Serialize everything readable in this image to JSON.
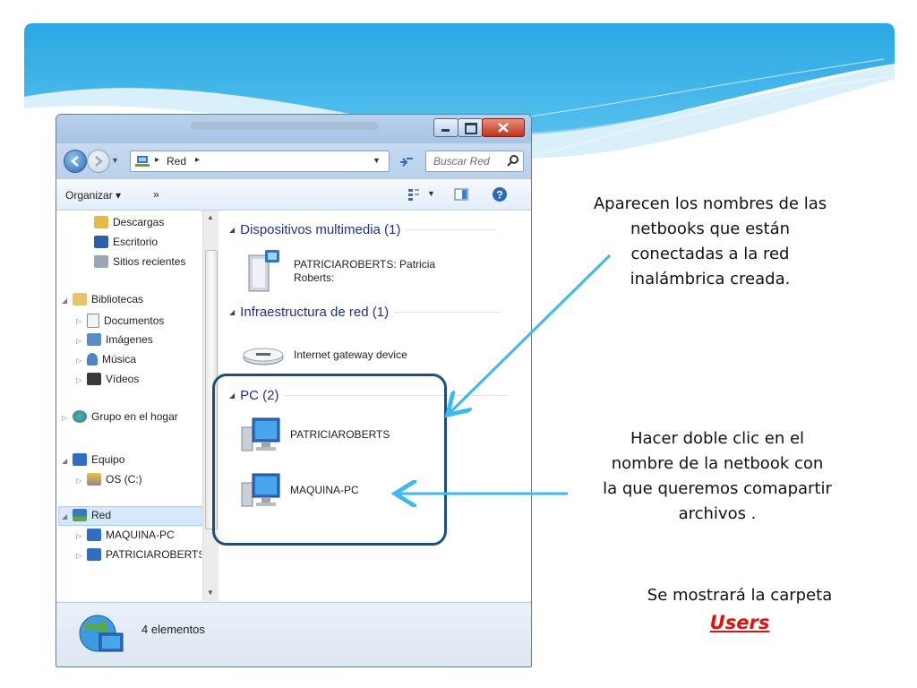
{
  "window": {
    "address_path": "Red",
    "search_placeholder": "Buscar Red",
    "toolbar": {
      "organize": "Organizar ▾",
      "more": "»"
    },
    "nav": {
      "downloads": "Descargas",
      "desktop": "Escritorio",
      "recent": "Sitios recientes",
      "libraries": "Bibliotecas",
      "documents": "Documentos",
      "pictures": "Imágenes",
      "music": "Música",
      "videos": "Vídeos",
      "homegroup": "Grupo en el hogar",
      "computer": "Equipo",
      "os_drive": "OS (C:)",
      "network": "Red",
      "net_item_1": "MAQUINA-PC",
      "net_item_2": "PATRICIAROBERTS"
    },
    "groups": {
      "multimedia": "Dispositivos multimedia (1)",
      "infra": "Infraestructura de red (1)",
      "pc": "PC (2)"
    },
    "items": {
      "media_device": "PATRICIAROBERTS: Patricia Roberts:",
      "gateway": "Internet gateway device",
      "pc1": "PATRICIAROBERTS",
      "pc2": "MAQUINA-PC"
    },
    "status_count": "4 elementos"
  },
  "callouts": {
    "top": [
      "Aparecen los nombres de las",
      "netbooks que están",
      "conectadas a la red",
      "inalámbrica creada."
    ],
    "middle": [
      "Hacer doble clic en el",
      "nombre de la netbook  con",
      "la que queremos comapartir",
      "archivos ."
    ],
    "bottom_line": "Se mostrará la carpeta",
    "bottom_folder": "Users"
  },
  "colors": {
    "banner": "#34aee6",
    "highlight_box": "#1f4f78",
    "arrow": "#3db8f0",
    "users_text": "#e0140f"
  }
}
